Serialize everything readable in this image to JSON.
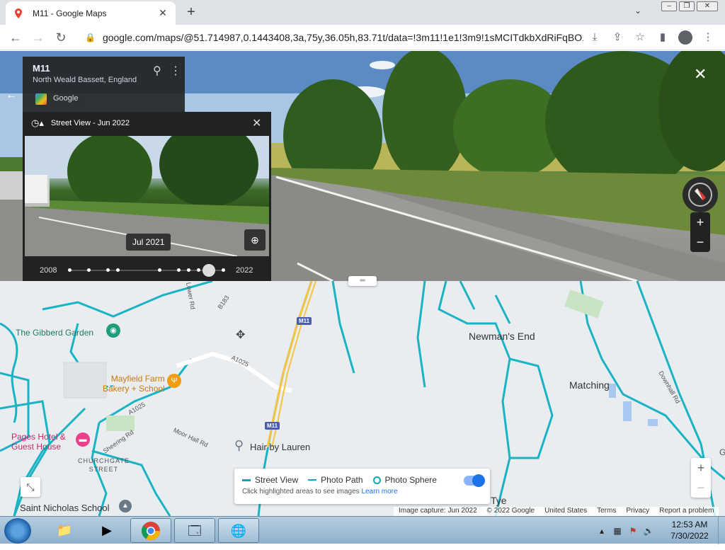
{
  "browser": {
    "tab_title": "M11 - Google Maps",
    "url": "google.com/maps/@51.714987,0.1443408,3a,75y,36.05h,83.71t/data=!3m11!1e1!3m9!1sMCITdkbXdRiFqBO..."
  },
  "info_card": {
    "title": "M11",
    "subtitle": "North Weald Bassett, England",
    "provider": "Google"
  },
  "timeline": {
    "header": "Street View - Jun 2022",
    "preview_date": "Jul 2021",
    "year_start": "2008",
    "year_end": "2022"
  },
  "map": {
    "labels": {
      "gibberd_garden": "The Gibberd Garden",
      "newmans_end": "Newman's End",
      "matching": "Matching",
      "mayfield_line1": "Mayfield Farm",
      "mayfield_line2": "Bakery + School",
      "pages_line1": "Pages Hotel &",
      "pages_line2": "Guest House",
      "churchgate_line1": "CHURCHGATE",
      "churchgate_line2": "STREET",
      "hair_by_lauren": "Hair by Lauren",
      "saint_nicholas": "Saint Nicholas School",
      "tye": "Tye",
      "b183": "B183",
      "a1025_1": "A1025",
      "a1025_2": "A1025",
      "m11_top": "M11",
      "m11_bottom": "M11",
      "moor_hall_rd": "Moor Hall Rd",
      "sheering_rd": "Sheering Rd",
      "lower_rd": "Lower Rd",
      "downhall_rd": "Downhall Rd",
      "edge_g": "G"
    },
    "legend": {
      "street_view": "Street View",
      "photo_path": "Photo Path",
      "photo_sphere": "Photo Sphere",
      "hint": "Click highlighted areas to see images",
      "learn_more": "Learn more"
    },
    "attribution": {
      "capture": "Image capture: Jun 2022",
      "copyright": "© 2022 Google",
      "region": "United States",
      "terms": "Terms",
      "privacy": "Privacy",
      "report": "Report a problem"
    }
  },
  "taskbar": {
    "time": "12:53 AM",
    "date": "7/30/2022"
  }
}
